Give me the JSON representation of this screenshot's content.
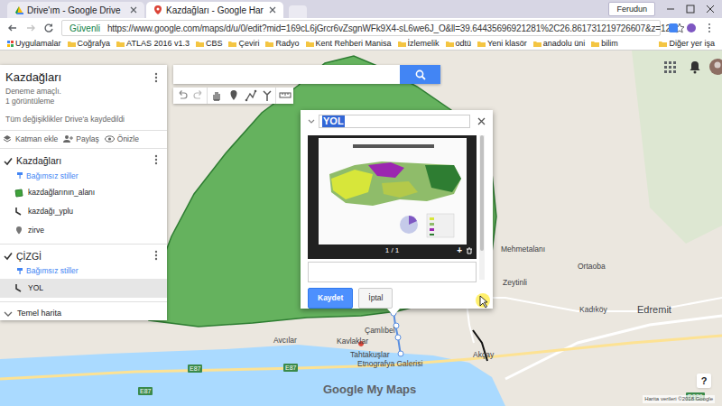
{
  "browser": {
    "tabs": [
      {
        "label": "Drive'ım - Google Drive",
        "selected": false
      },
      {
        "label": "Kazdağları - Google Har",
        "selected": true
      }
    ],
    "profile": "Ferudun",
    "secure": "Güvenli",
    "url": "https://www.google.com/maps/d/u/0/edit?mid=169cL6jGrcr6vZsgnWFk9X4-sL6we6J_O&ll=39.64435696921281%2C26.861731219726607&z=12",
    "bookmarks": [
      "Uygulamalar",
      "Coğrafya",
      "ATLAS 2016 v1.3",
      "CBS",
      "Çeviri",
      "Radyo",
      "Kent Rehberi Manisa",
      "İzlemelik",
      "odtü",
      "Yeni klasör",
      "anadolu üni",
      "bilim"
    ],
    "bookmarks_more": "Diğer yer işa"
  },
  "map_panel": {
    "title": "Kazdağları",
    "description": "Deneme amaçlı.",
    "views": "1 görüntüleme",
    "save_status": "Tüm değişiklikler Drive'a kaydedildi",
    "actions": [
      "Katman ekle",
      "Paylaş",
      "Önizle"
    ],
    "layers": [
      {
        "name": "Kazdağları",
        "checked": true,
        "style": "Bağımsız stiller",
        "items": [
          {
            "label": "kazdağlarının_alanı",
            "kind": "polygon",
            "selected": false
          },
          {
            "label": "kazdağı_yplu",
            "kind": "line",
            "selected": false
          },
          {
            "label": "zirve",
            "kind": "point",
            "selected": false
          }
        ]
      },
      {
        "name": "ÇİZGİ",
        "checked": true,
        "style": "Bağımsız stiller",
        "items": [
          {
            "label": "YOL",
            "kind": "line",
            "selected": true
          }
        ]
      }
    ],
    "base_map": "Temel harita"
  },
  "dialog": {
    "title": "YOL",
    "counter": "1 / 1",
    "add": "+",
    "buttons": [
      "Kaydet",
      "İptal"
    ]
  },
  "map_labels": [
    "Mehmetalanı",
    "Ortaoba",
    "Zeytinli",
    "Kadıköy",
    "Edremit",
    "Çamlıbel",
    "Avcılar",
    "Kavlaklar",
    "Tahtakuşlar",
    "Etnografya Galerisi",
    "Akçay"
  ],
  "road_shields": [
    "E87",
    "E87",
    "E87",
    "D230"
  ],
  "branding": "Google My Maps",
  "attribution": "Harita verileri ©2018 Google",
  "help": "?"
}
